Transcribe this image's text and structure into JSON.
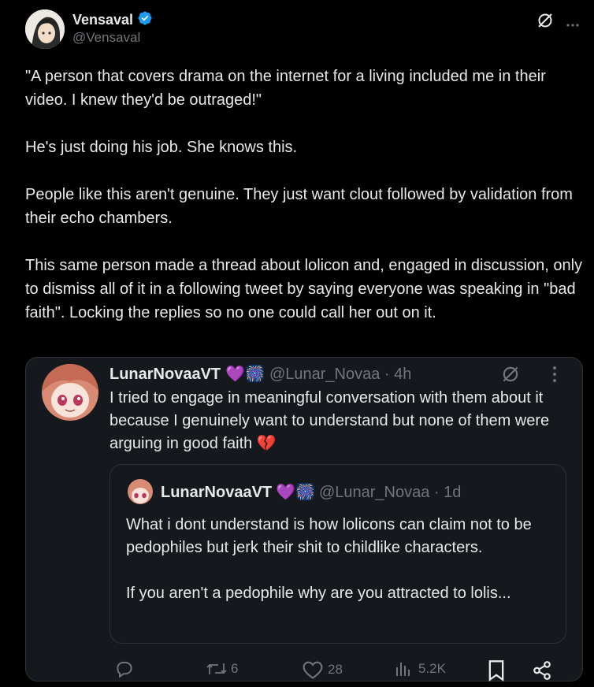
{
  "tweet": {
    "display_name": "Vensaval",
    "handle": "@Vensaval",
    "text": "\"A person that covers drama on the internet for a living included me in their video. I knew they'd be outraged!\"\n\nHe's just doing his job. She knows this.\n\nPeople like this aren't genuine. They just want clout followed by validation from their echo chambers.\n\nThis same person made a thread about lolicon and, engaged in discussion, only to dismiss all of it in a following tweet by saying everyone was speaking in \"bad faith\". Locking the replies so no one could call her out on it."
  },
  "quoted": {
    "display_name": "LunarNovaaVT",
    "emoji": "💜🎆",
    "handle_time": "@Lunar_Novaa · 4h",
    "text": "I tried to engage in meaningful conversation with them about it because I genuinely want to understand but none of them were arguing in good faith 💔",
    "nested": {
      "display_name": "LunarNovaaVT",
      "emoji": "💜🎆",
      "handle_time": "@Lunar_Novaa · 1d",
      "text": "What i dont understand is how lolicons can claim not to be pedophiles but jerk their shit to childlike characters.\n\nIf you aren't a pedophile why are you attracted to lolis..."
    },
    "actions": {
      "reply_count": "",
      "repost_count": "6",
      "like_count": "28",
      "view_count": "5.2K"
    }
  },
  "icons": {
    "verified": "verified-badge-icon",
    "grok": "grok-icon",
    "more": "more-icon",
    "reply": "reply-icon",
    "repost": "repost-icon",
    "like": "like-icon",
    "views": "views-icon",
    "bookmark": "bookmark-icon",
    "share": "share-icon"
  },
  "colors": {
    "background": "#000000",
    "card": "#15181c",
    "text": "#e7e9ea",
    "muted": "#71767b",
    "verified": "#1d9bf0"
  }
}
